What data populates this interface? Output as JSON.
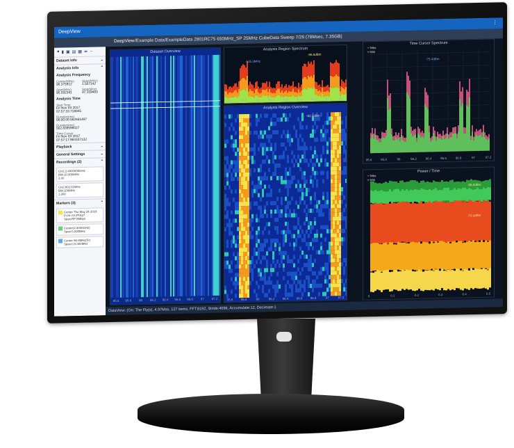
{
  "window": {
    "title": "DeepView",
    "path": "/Example Data/ExampleData 2801RC75 650MHz_SP 25MHz CubeData Sweep 7/26 (78Msec, 7.35GB)"
  },
  "sidebar": {
    "toolbar_icons": [
      "record-icon",
      "document-icon",
      "save-icon",
      "folder-icon",
      "print-icon",
      "split-icon",
      "back-icon"
    ],
    "dataset_info": "Dataset Info",
    "analysis_info": "Analysis Info",
    "analysis_frequency": "Analysis Frequency",
    "center_label": "Center(MHz)",
    "center_value": "96.375912",
    "span_label": "Span(MHz)",
    "span_value": "1.567142",
    "start_label": "Start(MHz)",
    "start_value": "95.592341",
    "stop_label": "Stop(MHz)",
    "stop_value": "97.159483",
    "analysis_time": "Analysis Time",
    "start_time_label": "Start Time",
    "start_time_value": "Fri Nov 03 2017 07:57:16:718045",
    "duration_label": "Duration(ms)",
    "duration_value": "00:00:00.562661497",
    "samples_label": "Duration(ms)",
    "samples_value": "562.839596027",
    "cursor_label": "Time Cursor",
    "cursor_value": "Fri Nov 03 2017 07:57:17:963107132",
    "playback": "Playback",
    "general_settings": "General Settings",
    "recordings": "Recordings (2)",
    "rec1": [
      "CH1:2.4000000GHz",
      "BW:10.000MHz",
      "2.00"
    ],
    "rec2": [
      "CH2:602.01MHz",
      "BW:100MHz",
      "1.000"
    ],
    "markers": "Markers (3)",
    "markers_list": [
      {
        "l1": "Center Thu May 24 2018",
        "l2": "Fr:Hr:SS,Pf:627",
        "l3": "Span:RF:5Mbps",
        "color": "#f2e552"
      },
      {
        "l1": "Center(2.4000GHz)",
        "l2": "Span:5.000MHz",
        "l3": "",
        "color": "#6bd17a"
      },
      {
        "l1": "Center 96.0MHz(Fr)",
        "l2": "Span:0.5.000MHz",
        "l3": "",
        "color": "#5aa8f0"
      }
    ]
  },
  "panels": {
    "waterfall_title": "Dataset Overview",
    "spectrum_title": "Analysis Region Spectrum",
    "overview_title": "Analysis Region Overview",
    "time_cursor_title": "Time Cursor Spectrum",
    "power_time_title": "Power / Time",
    "legend_max": "Max",
    "legend_min": "Min",
    "legend_avg": "Avg",
    "freq_unit": "MHz",
    "db_label_1": "-135.3MHz",
    "db_label_2": "-75.4dBm",
    "db_label_3": "-56.6dBm",
    "db_label_4": "-62.1dBm",
    "power_readout_1": "-68.0dBm",
    "power_readout_2": "-72.1dBm",
    "x_ticks": [
      "95.6",
      "95.8",
      "96",
      "96.2",
      "96.4",
      "96.6",
      "96.8",
      "97",
      "97.2"
    ],
    "time_ticks": [
      "0",
      "0.1",
      "0.2",
      "0.3",
      "0.4",
      "0.5"
    ]
  },
  "statusbar": "DataView: (On: The Fly(s), 4.97Mss, 127 items, FFT:8192, Stride:4096, Accumulate:12, Decimate:1"
}
